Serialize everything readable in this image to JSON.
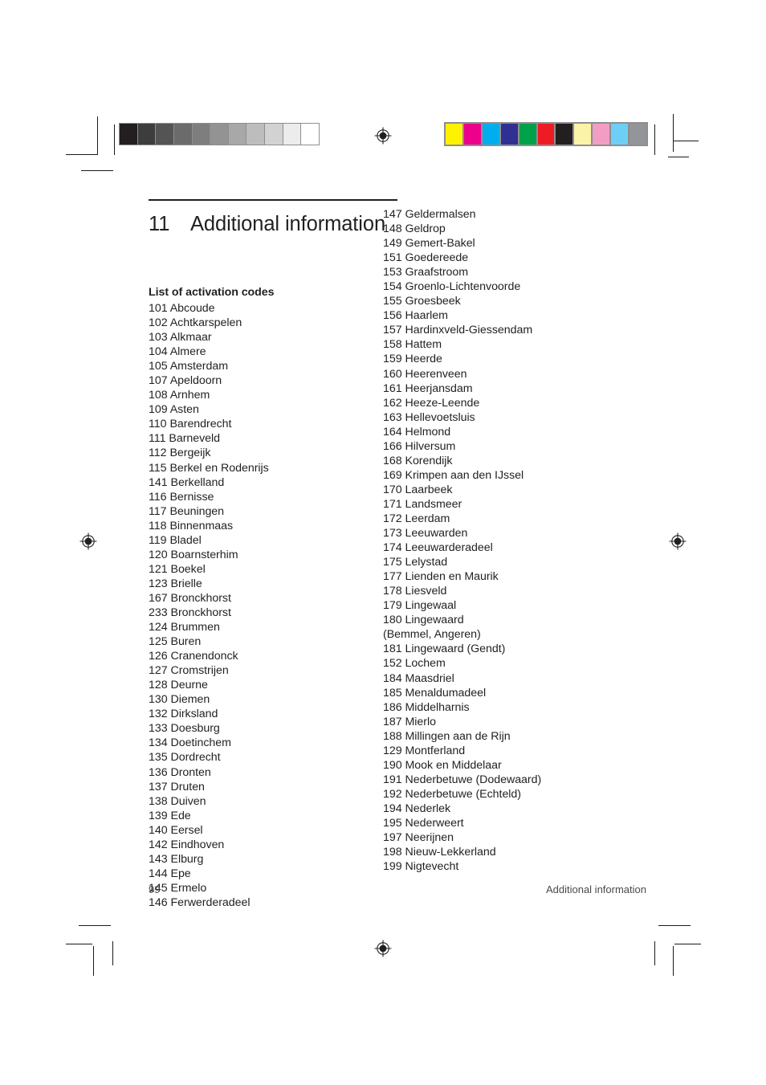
{
  "document": {
    "page_number": "99",
    "running_footer": "Additional information"
  },
  "chapter": {
    "number": "11",
    "title": "Additional information"
  },
  "section": {
    "subheading": "List of activation codes"
  },
  "press_marks": {
    "grey_wedge": {
      "name": "grayscale-step-wedge",
      "steps": [
        "#231f20",
        "#3d3d3d",
        "#545454",
        "#6b6b6b",
        "#7e7e7e",
        "#939393",
        "#a8a8a8",
        "#bdbdbd",
        "#d2d2d2",
        "#ececec",
        "#ffffff"
      ]
    },
    "color_bar": {
      "name": "cmyk-color-control-bar",
      "swatches": [
        "#fff200",
        "#ec008c",
        "#00aeef",
        "#2e3192",
        "#00a14b",
        "#ed1c24",
        "#231f20",
        "#fbf3a8",
        "#f29ec4",
        "#6dcff6",
        "#939598"
      ]
    },
    "registration_marks": 4
  },
  "codes": {
    "left_column": [
      {
        "code": "101",
        "name": "Abcoude"
      },
      {
        "code": "102",
        "name": "Achtkarspelen"
      },
      {
        "code": "103",
        "name": "Alkmaar"
      },
      {
        "code": "104",
        "name": "Almere"
      },
      {
        "code": "105",
        "name": "Amsterdam"
      },
      {
        "code": "107",
        "name": "Apeldoorn"
      },
      {
        "code": "108",
        "name": "Arnhem"
      },
      {
        "code": "109",
        "name": "Asten"
      },
      {
        "code": "110",
        "name": "Barendrecht"
      },
      {
        "code": "111",
        "name": "Barneveld"
      },
      {
        "code": "112",
        "name": "Bergeijk"
      },
      {
        "code": "115",
        "name": "Berkel en Rodenrijs"
      },
      {
        "code": "141",
        "name": "Berkelland"
      },
      {
        "code": "116",
        "name": "Bernisse"
      },
      {
        "code": "117",
        "name": "Beuningen"
      },
      {
        "code": "118",
        "name": "Binnenmaas"
      },
      {
        "code": "119",
        "name": "Bladel"
      },
      {
        "code": "120",
        "name": "Boarnsterhim"
      },
      {
        "code": "121",
        "name": "Boekel"
      },
      {
        "code": "123",
        "name": "Brielle"
      },
      {
        "code": "167",
        "name": "Bronckhorst"
      },
      {
        "code": "233",
        "name": "Bronckhorst"
      },
      {
        "code": "124",
        "name": "Brummen"
      },
      {
        "code": "125",
        "name": "Buren"
      },
      {
        "code": "126",
        "name": "Cranendonck"
      },
      {
        "code": "127",
        "name": "Cromstrijen"
      },
      {
        "code": "128",
        "name": "Deurne"
      },
      {
        "code": "130",
        "name": "Diemen"
      },
      {
        "code": "132",
        "name": "Dirksland"
      },
      {
        "code": "133",
        "name": "Doesburg"
      },
      {
        "code": "134",
        "name": "Doetinchem"
      },
      {
        "code": "135",
        "name": "Dordrecht"
      },
      {
        "code": "136",
        "name": "Dronten"
      },
      {
        "code": "137",
        "name": "Druten"
      },
      {
        "code": "138",
        "name": "Duiven"
      },
      {
        "code": "139",
        "name": "Ede"
      },
      {
        "code": "140",
        "name": "Eersel"
      },
      {
        "code": "142",
        "name": "Eindhoven"
      },
      {
        "code": "143",
        "name": "Elburg"
      },
      {
        "code": "144",
        "name": "Epe"
      },
      {
        "code": "145",
        "name": "Ermelo"
      },
      {
        "code": "146",
        "name": "Ferwerderadeel"
      }
    ],
    "right_column": [
      {
        "code": "147",
        "name": "Geldermalsen"
      },
      {
        "code": "148",
        "name": "Geldrop"
      },
      {
        "code": "149",
        "name": "Gemert-Bakel"
      },
      {
        "code": "151",
        "name": "Goedereede"
      },
      {
        "code": "153",
        "name": "Graafstroom"
      },
      {
        "code": "154",
        "name": "Groenlo-Lichtenvoorde"
      },
      {
        "code": "155",
        "name": "Groesbeek"
      },
      {
        "code": "156",
        "name": "Haarlem"
      },
      {
        "code": "157",
        "name": "Hardinxveld-Giessendam"
      },
      {
        "code": "158",
        "name": "Hattem"
      },
      {
        "code": "159",
        "name": "Heerde"
      },
      {
        "code": "160",
        "name": "Heerenveen"
      },
      {
        "code": "161",
        "name": "Heerjansdam"
      },
      {
        "code": "162",
        "name": "Heeze-Leende"
      },
      {
        "code": "163",
        "name": "Hellevoetsluis"
      },
      {
        "code": "164",
        "name": "Helmond"
      },
      {
        "code": "166",
        "name": "Hilversum"
      },
      {
        "code": "168",
        "name": "Korendijk"
      },
      {
        "code": "169",
        "name": "Krimpen aan den IJssel"
      },
      {
        "code": "170",
        "name": "Laarbeek"
      },
      {
        "code": "171",
        "name": "Landsmeer"
      },
      {
        "code": "172",
        "name": "Leerdam"
      },
      {
        "code": "173",
        "name": "Leeuwarden"
      },
      {
        "code": "174",
        "name": "Leeuwarderadeel"
      },
      {
        "code": "175",
        "name": "Lelystad"
      },
      {
        "code": "177",
        "name": "Lienden en Maurik"
      },
      {
        "code": "178",
        "name": "Liesveld"
      },
      {
        "code": "179",
        "name": "Lingewaal"
      },
      {
        "code": "180",
        "name": "Lingewaard"
      },
      {
        "code": "",
        "name": "(Bemmel, Angeren)"
      },
      {
        "code": "181",
        "name": "Lingewaard (Gendt)"
      },
      {
        "code": "152",
        "name": "Lochem"
      },
      {
        "code": "184",
        "name": "Maasdriel"
      },
      {
        "code": "185",
        "name": "Menaldumadeel"
      },
      {
        "code": "186",
        "name": "Middelharnis"
      },
      {
        "code": "187",
        "name": "Mierlo"
      },
      {
        "code": "188",
        "name": "Millingen aan de Rijn"
      },
      {
        "code": "129",
        "name": "Montferland"
      },
      {
        "code": "190",
        "name": "Mook en Middelaar"
      },
      {
        "code": "191",
        "name": "Nederbetuwe (Dodewaard)"
      },
      {
        "code": "192",
        "name": "Nederbetuwe (Echteld)"
      },
      {
        "code": "194",
        "name": "Nederlek"
      },
      {
        "code": "195",
        "name": "Nederweert"
      },
      {
        "code": "197",
        "name": "Neerijnen"
      },
      {
        "code": "198",
        "name": "Nieuw-Lekkerland"
      },
      {
        "code": "199",
        "name": "Nigtevecht"
      }
    ]
  }
}
